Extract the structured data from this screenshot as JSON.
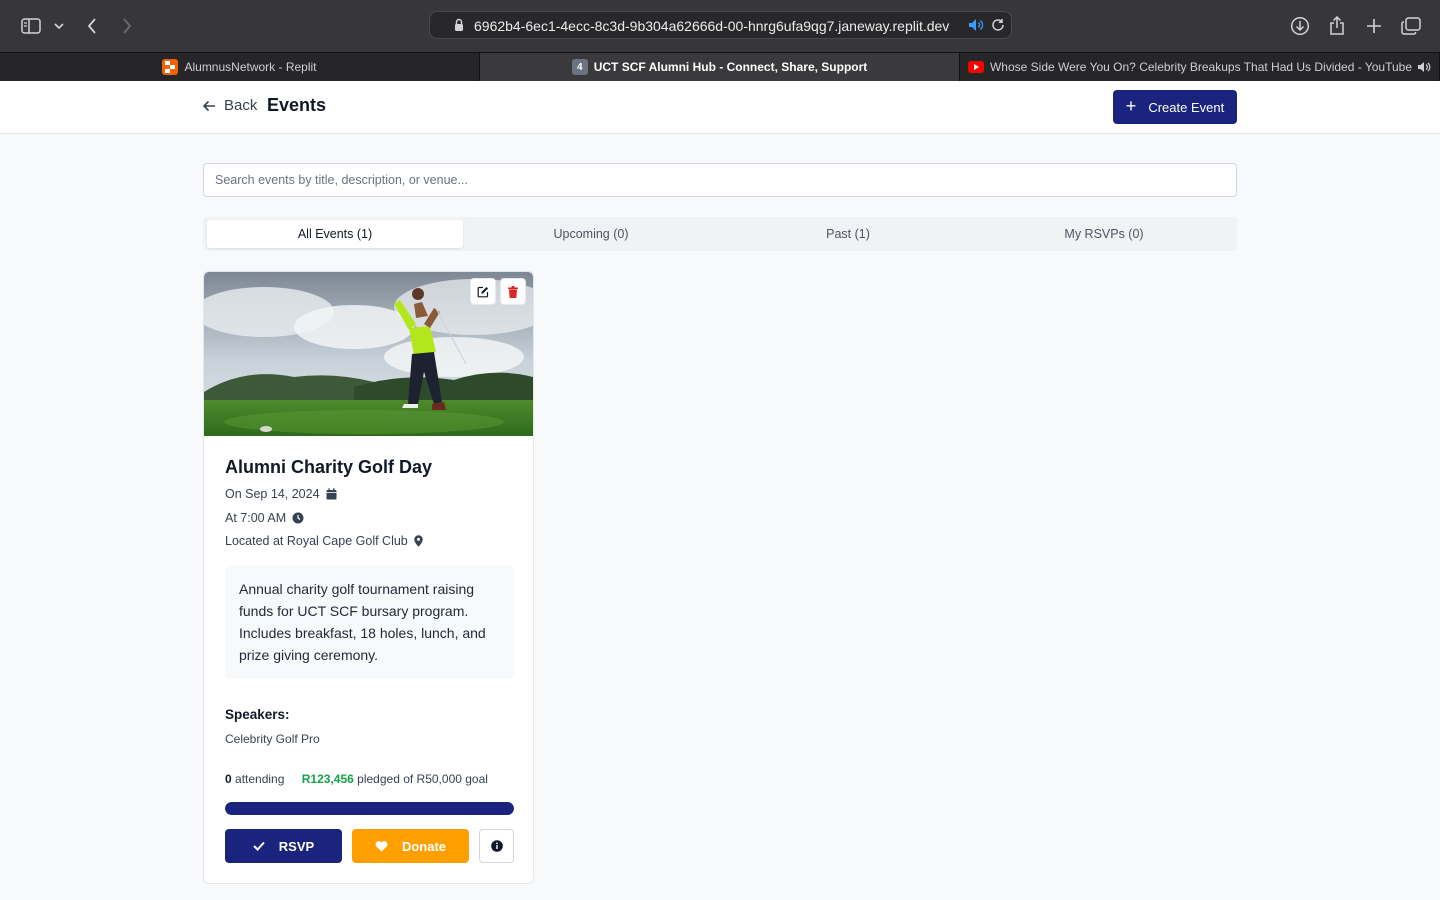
{
  "browser": {
    "url": "6962b4-6ec1-4ecc-8c3d-9b304a62666d-00-hnrg6ufa9qg7.janeway.replit.dev",
    "tabs": [
      {
        "title": "AlumnusNetwork - Replit",
        "favicon": "replit-icon"
      },
      {
        "title": "UCT SCF Alumni Hub - Connect, Share, Support",
        "favicon_text": "4",
        "active": true
      },
      {
        "title": "Whose Side Were You On? Celebrity Breakups That Had Us Divided - YouTube",
        "favicon": "youtube-icon"
      }
    ]
  },
  "header": {
    "back_label": "Back",
    "title": "Events",
    "create_label": "Create Event"
  },
  "search": {
    "placeholder": "Search events by title, description, or venue...",
    "value": ""
  },
  "filter_tabs": [
    {
      "label": "All Events (1)",
      "active": true
    },
    {
      "label": "Upcoming (0)"
    },
    {
      "label": "Past (1)"
    },
    {
      "label": "My RSVPs (0)"
    }
  ],
  "event": {
    "title": "Alumni Charity Golf Day",
    "date": "On Sep 14, 2024",
    "time": "At 7:00 AM",
    "location": "Located at Royal Cape Golf Club",
    "description": "Annual charity golf tournament raising funds for UCT SCF bursary program. Includes breakfast, 18 holes, lunch, and prize giving ceremony.",
    "speakers_heading": "Speakers:",
    "speakers": "Celebrity Golf Pro",
    "attending_count": "0",
    "attending_label": "attending",
    "pledged_amount": "R123,456",
    "pledged_label": "pledged of R50,000 goal",
    "progress_fraction": 1.0,
    "rsvp_label": "RSVP",
    "donate_label": "Donate"
  },
  "colors": {
    "primary": "#1a237e",
    "donate": "#ffa000",
    "success": "#16a34a",
    "delete": "#dc2626"
  }
}
